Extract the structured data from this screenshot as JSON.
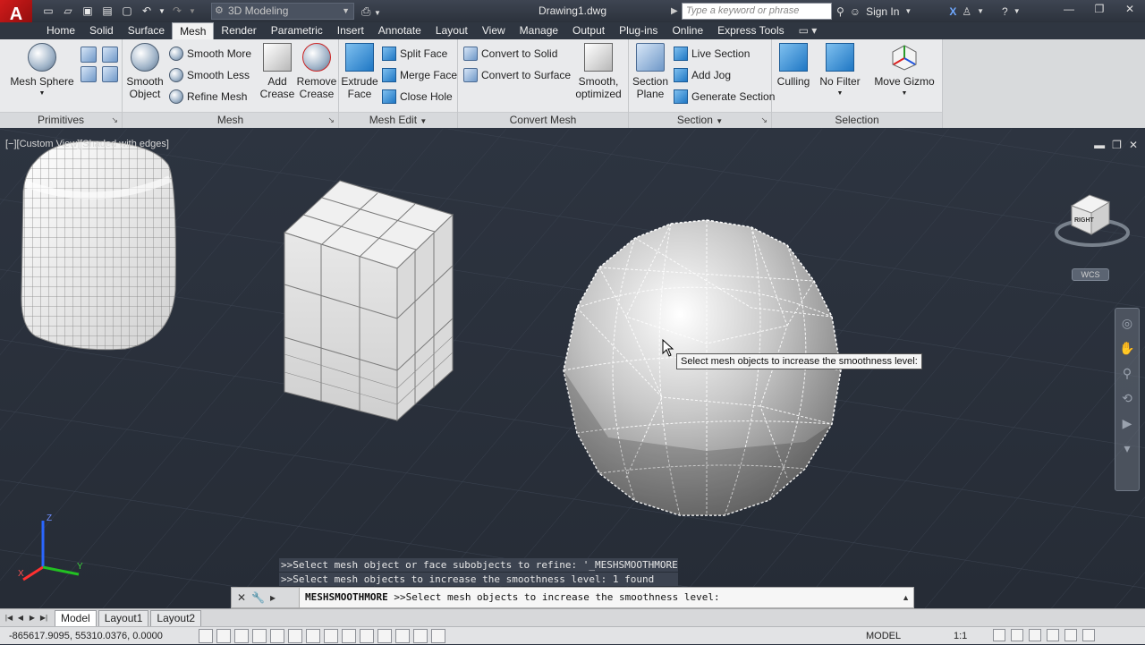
{
  "app": {
    "logo_letter": "A",
    "document_title": "Drawing1.dwg"
  },
  "workspace": {
    "selected": "3D Modeling"
  },
  "search": {
    "placeholder": "Type a keyword or phrase"
  },
  "account": {
    "sign_in": "Sign In"
  },
  "ribbon_tabs": [
    "Home",
    "Solid",
    "Surface",
    "Mesh",
    "Render",
    "Parametric",
    "Insert",
    "Annotate",
    "Layout",
    "View",
    "Manage",
    "Output",
    "Plug-ins",
    "Online",
    "Express Tools"
  ],
  "active_tab": "Mesh",
  "panels": {
    "primitives": {
      "title": "Primitives",
      "mesh_sphere": "Mesh Sphere"
    },
    "mesh": {
      "title": "Mesh",
      "smooth_object_1": "Smooth",
      "smooth_object_2": "Object",
      "smooth_more": "Smooth More",
      "smooth_less": "Smooth Less",
      "refine_mesh": "Refine Mesh",
      "add_crease_1": "Add",
      "add_crease_2": "Crease",
      "remove_crease_1": "Remove",
      "remove_crease_2": "Crease"
    },
    "mesh_edit": {
      "title": "Mesh Edit",
      "extrude_face_1": "Extrude",
      "extrude_face_2": "Face",
      "split_face": "Split Face",
      "merge_face": "Merge Face",
      "close_hole": "Close Hole"
    },
    "convert_mesh": {
      "title": "Convert Mesh",
      "convert_to_solid": "Convert to Solid",
      "convert_to_surface": "Convert to Surface",
      "smooth_optimized_1": "Smooth,",
      "smooth_optimized_2": "optimized"
    },
    "section": {
      "title": "Section",
      "section_plane_1": "Section",
      "section_plane_2": "Plane",
      "live_section": "Live Section",
      "add_jog": "Add Jog",
      "generate_section": "Generate Section"
    },
    "selection": {
      "title": "Selection",
      "culling": "Culling",
      "no_filter": "No Filter",
      "move_gizmo": "Move Gizmo"
    }
  },
  "viewport": {
    "label": "[−][Custom View][Shaded with edges]",
    "tooltip": "Select mesh objects to increase the smoothness level:",
    "wcs": "WCS",
    "viewcube_face": "RIGHT"
  },
  "command_history": [
    ">>Select mesh object or face subobjects to refine: '_MESHSMOOTHMORE",
    ">>Select mesh objects to increase the smoothness level: 1 found"
  ],
  "command_line": {
    "command": "MESHSMOOTHMORE",
    "prompt": ">>Select mesh objects to increase the smoothness level:"
  },
  "layout_tabs": [
    "Model",
    "Layout1",
    "Layout2"
  ],
  "status": {
    "coordinates": "-865617.9095, 55310.0376, 0.0000",
    "mode": "MODEL",
    "scale": "1:1"
  }
}
